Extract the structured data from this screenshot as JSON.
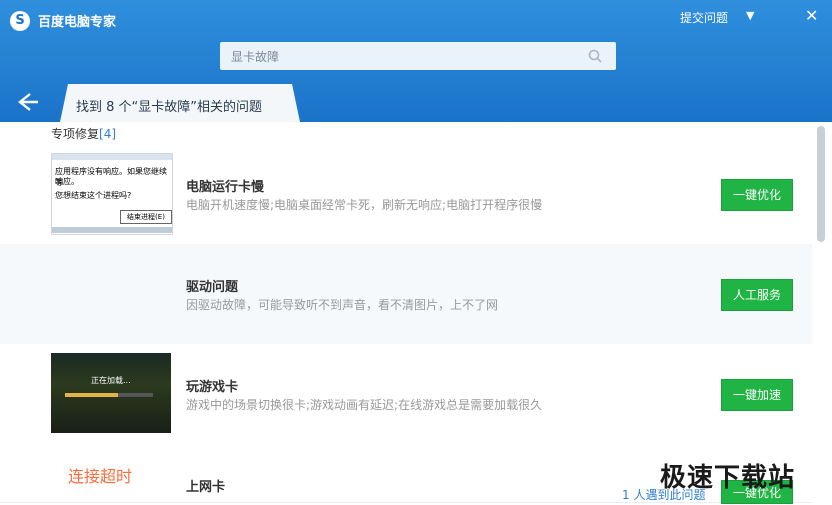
{
  "app": {
    "title": "百度电脑专家",
    "submit_label": "提交问题"
  },
  "search": {
    "value": "显卡故障"
  },
  "result": {
    "text": "找到 8 个“显卡故障”相关的问题"
  },
  "section": {
    "label": "专项修复",
    "count": "[4]"
  },
  "rows": [
    {
      "title": "电脑运行卡慢",
      "desc": "电脑开机速度慢;电脑桌面经常卡死，刷新无响应;电脑打开程序很慢",
      "button": "一键优化",
      "thumb": {
        "line1": "应用程序没有响应。如果您继续等",
        "line2": "响应。",
        "line3": "您想结束这个进程吗?",
        "button": "结束进程(E)"
      }
    },
    {
      "title": "驱动问题",
      "desc": "因驱动故障，可能导致听不到声音，看不清图片，上不了网",
      "button": "人工服务"
    },
    {
      "title": "玩游戏卡",
      "desc": "游戏中的场景切换很卡;游戏动画有延迟;在线游戏总是需要加载很久",
      "button": "一键加速",
      "thumb": {
        "text": "正在加载..."
      }
    },
    {
      "title": "上网卡",
      "footer": "1 人遇到此问题",
      "button": "一键优化",
      "timeout": "连接超时"
    }
  ],
  "watermark": "极速下载站",
  "colors": {
    "header": "#1b73c9",
    "accent_button": "#1fb444",
    "link": "#2f80d1",
    "timeout": "#ff6b3a"
  }
}
